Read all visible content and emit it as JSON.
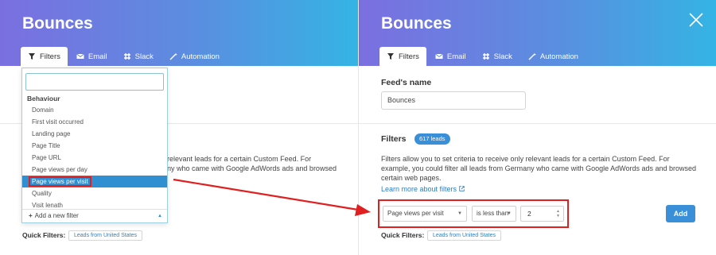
{
  "left": {
    "title": "Bounces",
    "tabs": [
      {
        "label": "Filters",
        "icon": "filter-icon"
      },
      {
        "label": "Email",
        "icon": "envelope-icon"
      },
      {
        "label": "Slack",
        "icon": "slack-icon"
      },
      {
        "label": "Automation",
        "icon": "wand-icon"
      }
    ],
    "dropdown": {
      "search_value": "",
      "group": "Behaviour",
      "items": [
        "Domain",
        "First visit occurred",
        "Landing page",
        "Page Title",
        "Page URL",
        "Page views per day",
        "Page views per visit",
        "Quality",
        "Visit lenath"
      ],
      "selected": "Page views per visit",
      "add_filter": "Add a new filter"
    },
    "partial_lines": [
      "relevant leads for a certain Custom Feed. For",
      "ny who came with Google AdWords ads and browsed"
    ],
    "quick_filters_label": "Quick Filters:",
    "quick_filter_button": "Leads from United States"
  },
  "right": {
    "title": "Bounces",
    "tabs": [
      {
        "label": "Filters",
        "icon": "filter-icon"
      },
      {
        "label": "Email",
        "icon": "envelope-icon"
      },
      {
        "label": "Slack",
        "icon": "slack-icon"
      },
      {
        "label": "Automation",
        "icon": "wand-icon"
      }
    ],
    "feed_name_label": "Feed's name",
    "feed_name_value": "Bounces",
    "filters_heading": "Filters",
    "leads_badge": "617 leads",
    "description": "Filters allow you to set criteria to receive only relevant leads for a certain Custom Feed. For example, you could filter all leads from Germany who came with Google AdWords ads and browsed certain web pages.",
    "learn_more": "Learn more about filters",
    "filter_field": "Page views per visit",
    "filter_operator": "is less than",
    "filter_value": "2",
    "add_button": "Add",
    "quick_filters_label": "Quick Filters:",
    "quick_filter_button": "Leads from United States"
  },
  "colors": {
    "header_gradient_start": "#7b6fe0",
    "header_gradient_end": "#34b4e4",
    "accent_blue": "#3a8fd9",
    "highlight_red": "#e02020"
  }
}
